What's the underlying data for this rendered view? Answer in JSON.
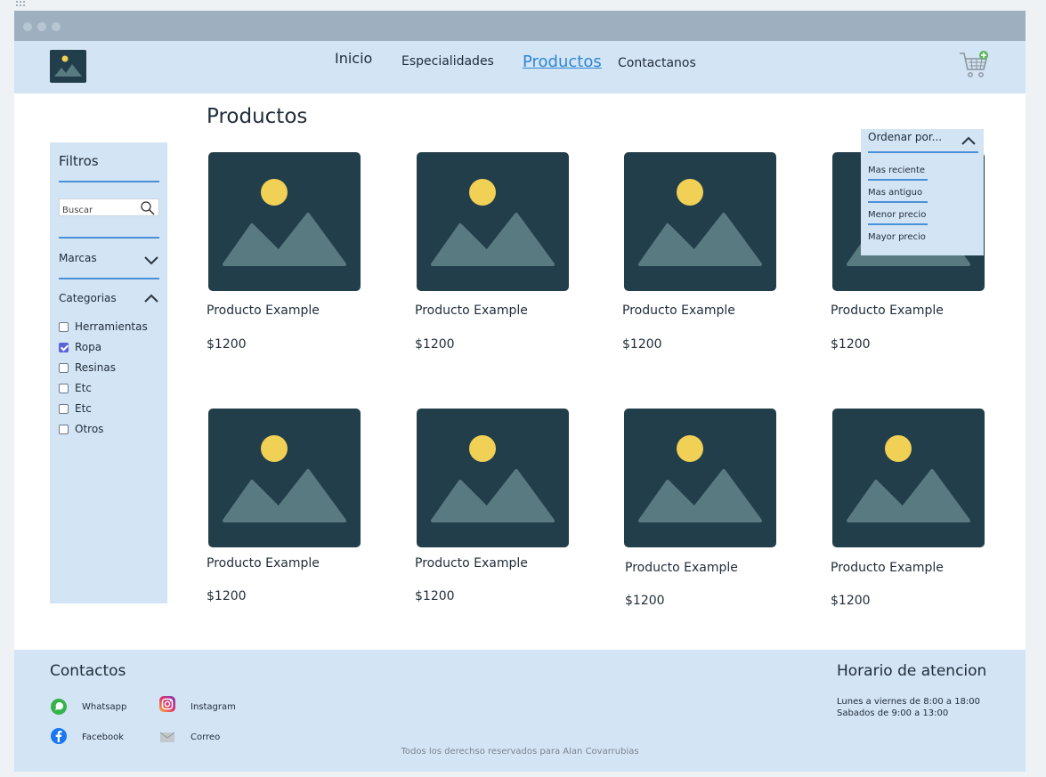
{
  "nav": {
    "items": [
      "Inicio",
      "Especialidades",
      "Productos",
      "Contactanos"
    ],
    "active": "Productos"
  },
  "page": {
    "title": "Productos"
  },
  "filters": {
    "title": "Filtros",
    "search_placeholder": "Buscar",
    "brands_label": "Marcas",
    "categories_label": "Categorias",
    "categories": [
      {
        "label": "Herramientas",
        "checked": false
      },
      {
        "label": "Ropa",
        "checked": true
      },
      {
        "label": "Resinas",
        "checked": false
      },
      {
        "label": "Etc",
        "checked": false
      },
      {
        "label": "Etc",
        "checked": false
      },
      {
        "label": "Otros",
        "checked": false
      }
    ]
  },
  "sort": {
    "label": "Ordenar por...",
    "options": [
      "Mas reciente",
      "Mas antiguo",
      "Menor precio",
      "Mayor precio"
    ]
  },
  "products": [
    {
      "name": "Producto Example",
      "price": "$1200"
    },
    {
      "name": "Producto Example",
      "price": "$1200"
    },
    {
      "name": "Producto Example",
      "price": "$1200"
    },
    {
      "name": "Producto Example",
      "price": "$1200"
    },
    {
      "name": "Producto Example",
      "price": "$1200"
    },
    {
      "name": "Producto Example",
      "price": "$1200"
    },
    {
      "name": "Producto Example",
      "price": "$1200"
    },
    {
      "name": "Producto Example",
      "price": "$1200"
    }
  ],
  "footer": {
    "contacts_title": "Contactos",
    "contacts": [
      {
        "label": "Whatsapp",
        "icon": "whatsapp-icon"
      },
      {
        "label": "Instagram",
        "icon": "instagram-icon"
      },
      {
        "label": "Facebook",
        "icon": "facebook-icon"
      },
      {
        "label": "Correo",
        "icon": "mail-icon"
      }
    ],
    "hours_title": "Horario de atencion",
    "hours_lines": [
      "Lunes a viernes de 8:00 a 18:00",
      "Sabados de 9:00 a 13:00"
    ],
    "copyright": "Todos los derechso reservados para Alan Covarrubias"
  },
  "colors": {
    "header_bg": "#d3e4f4",
    "accent": "#4a90d9",
    "image_bg": "#233e4b",
    "sun": "#f0d055",
    "mountain": "#5a7a82"
  }
}
